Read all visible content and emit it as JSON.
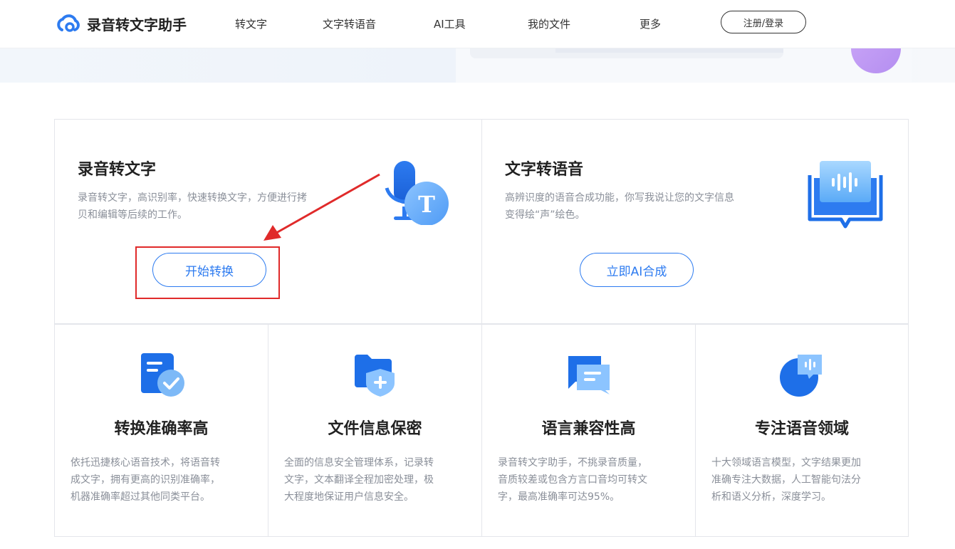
{
  "header": {
    "logo_text": "录音转文字助手",
    "nav": [
      "转文字",
      "文字转语音",
      "AI工具",
      "我的文件",
      "更多"
    ],
    "login": "注册/登录"
  },
  "cards": {
    "stt": {
      "title": "录音转文字",
      "desc_line1": "录音转文字，高识别率，快速转换文字，方便进行拷",
      "desc_line2": "贝和编辑等后续的工作。",
      "button": "开始转换"
    },
    "tts": {
      "title": "文字转语音",
      "desc_line1": "高辨识度的语音合成功能，你写我说让您的文字信息",
      "desc_line2": "变得绘“声”绘色。",
      "button": "立即AI合成"
    }
  },
  "features": [
    {
      "title": "转换准确率高",
      "lines": [
        "依托迅捷核心语音技术，将语音转",
        "成文字，拥有更高的识别准确率，",
        "机器准确率超过其他同类平台。"
      ],
      "icon": "document-check-icon"
    },
    {
      "title": "文件信息保密",
      "lines": [
        "全面的信息安全管理体系，记录转",
        "文字，文本翻译全程加密处理，极",
        "大程度地保证用户信息安全。"
      ],
      "icon": "folder-shield-icon"
    },
    {
      "title": "语言兼容性高",
      "lines": [
        "录音转文字助手，不挑录音质量，",
        "音质较差或包含方言口音均可转文",
        "字，最高准确率可达95%。"
      ],
      "icon": "chat-bubbles-icon"
    },
    {
      "title": "专注语音领域",
      "lines": [
        "十大领域语言模型，文字结果更加",
        "准确专注大数据，人工智能句法分",
        "析和语义分析，深度学习。"
      ],
      "icon": "voice-bubble-icon"
    }
  ],
  "colors": {
    "accent": "#2d7bf0",
    "highlight": "#e02a2a"
  }
}
